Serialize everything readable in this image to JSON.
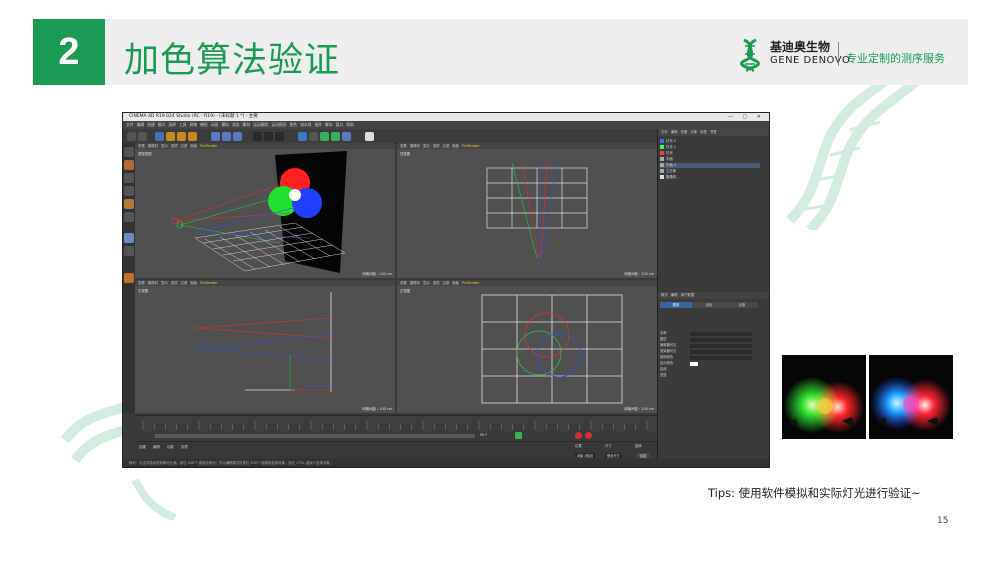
{
  "header": {
    "section_number": "2",
    "title": "加色算法验证"
  },
  "logo": {
    "name_cn": "基迪奥生物",
    "name_en": "GENE DENOVO",
    "slogan": "专业定制的测序服务"
  },
  "app": {
    "window_title": "CINEMA 4D R19.024 Studio (RC - R19) - [未标题 1 *] - 主要",
    "menu": [
      "文件",
      "编辑",
      "创建",
      "模式",
      "选择",
      "工具",
      "网格",
      "捕捉",
      "动画",
      "模拟",
      "渲染",
      "雕刻",
      "运动跟踪",
      "运动图形",
      "角色",
      "流水线",
      "插件",
      "脚本",
      "窗口",
      "帮助"
    ],
    "viewport_menu": [
      "查看",
      "摄像机",
      "显示",
      "选项",
      "过滤",
      "面板",
      "ProRender"
    ],
    "viewports": [
      {
        "label": "透视视图",
        "footer": "网格间距 : 100 cm"
      },
      {
        "label": "顶视图",
        "footer": "网格间距 : 100 cm"
      },
      {
        "label": "右视图",
        "footer": "网格间距 : 100 cm"
      },
      {
        "label": "正视图",
        "footer": "网格间距 : 100 cm"
      }
    ],
    "object_panel_tabs": [
      "文件",
      "编辑",
      "查看",
      "对象",
      "标签",
      "书签"
    ],
    "objects": [
      {
        "name": "灯光.2",
        "color": "#3a6cff"
      },
      {
        "name": "灯光.1",
        "color": "#3aff5a"
      },
      {
        "name": "灯光",
        "color": "#ff3a3a"
      },
      {
        "name": "平面",
        "color": "#aaaaaa"
      },
      {
        "name": "平面.1",
        "color": "#aaaaaa"
      },
      {
        "name": "立方体",
        "color": "#aaaaaa"
      },
      {
        "name": "摄像机",
        "color": "#dddddd"
      }
    ],
    "attr_tabs": [
      "模式",
      "编辑",
      "用户数据"
    ],
    "attr_sections": [
      "基本",
      "坐标",
      "对象"
    ],
    "attr_rows": [
      "名称",
      "图层",
      "编辑器可见",
      "渲染器可见",
      "使用颜色",
      "显示颜色",
      "启用",
      "透显"
    ],
    "bottom_tabs": [
      "创建",
      "编辑",
      "功能",
      "纹理"
    ],
    "coord_headers": [
      "位置",
      "尺寸",
      "旋转"
    ],
    "coord_buttons": [
      "对象 (相对)",
      "绝对尺寸",
      "应用"
    ],
    "timeline_end": "90 F",
    "status_text": "移动：点击并拖动鼠标移动元素。按住 SHIFT 键量化移动；节点编辑模式时按住 SHIFT 键增加选择对象；按住 CTRL 键减少选择对象。"
  },
  "tips": "Tips: 使用软件模拟和实际灯光进行验证~",
  "page_number": "15",
  "colors": {
    "brand_green": "#1a9a55",
    "light_red": "#ff2020",
    "light_green": "#20e030",
    "light_blue": "#2040ff"
  }
}
